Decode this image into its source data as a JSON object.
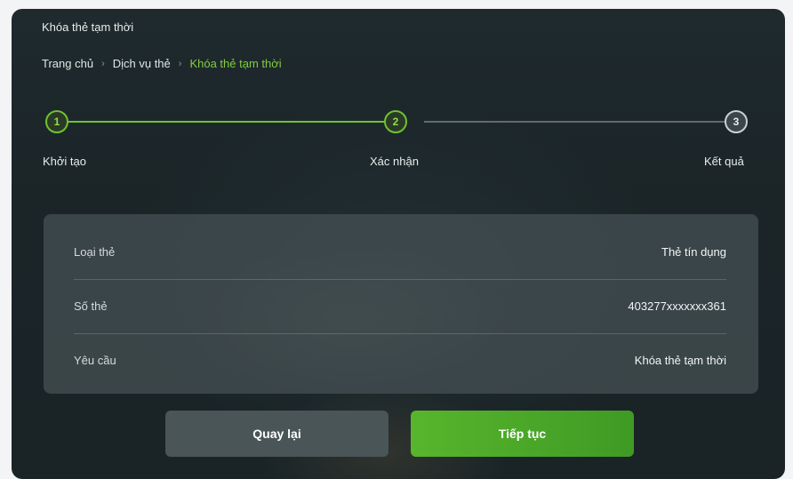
{
  "header": {
    "title": "Khóa thẻ tạm thời"
  },
  "breadcrumb": {
    "items": [
      "Trang chủ",
      "Dịch vụ thẻ",
      "Khóa thẻ tạm thời"
    ],
    "separator": "›"
  },
  "stepper": {
    "steps": [
      {
        "number": "1",
        "label": "Khởi tạo",
        "state": "done"
      },
      {
        "number": "2",
        "label": "Xác nhận",
        "state": "active"
      },
      {
        "number": "3",
        "label": "Kết quả",
        "state": "pending"
      }
    ],
    "active_color": "#6fc22e"
  },
  "details": {
    "rows": [
      {
        "label": "Loại thẻ",
        "value": "Thẻ tín dụng"
      },
      {
        "label": "Số thẻ",
        "value": "403277xxxxxxx361"
      },
      {
        "label": "Yêu cầu",
        "value": "Khóa thẻ tạm thời"
      }
    ]
  },
  "actions": {
    "back_label": "Quay lại",
    "next_label": "Tiếp tục"
  }
}
